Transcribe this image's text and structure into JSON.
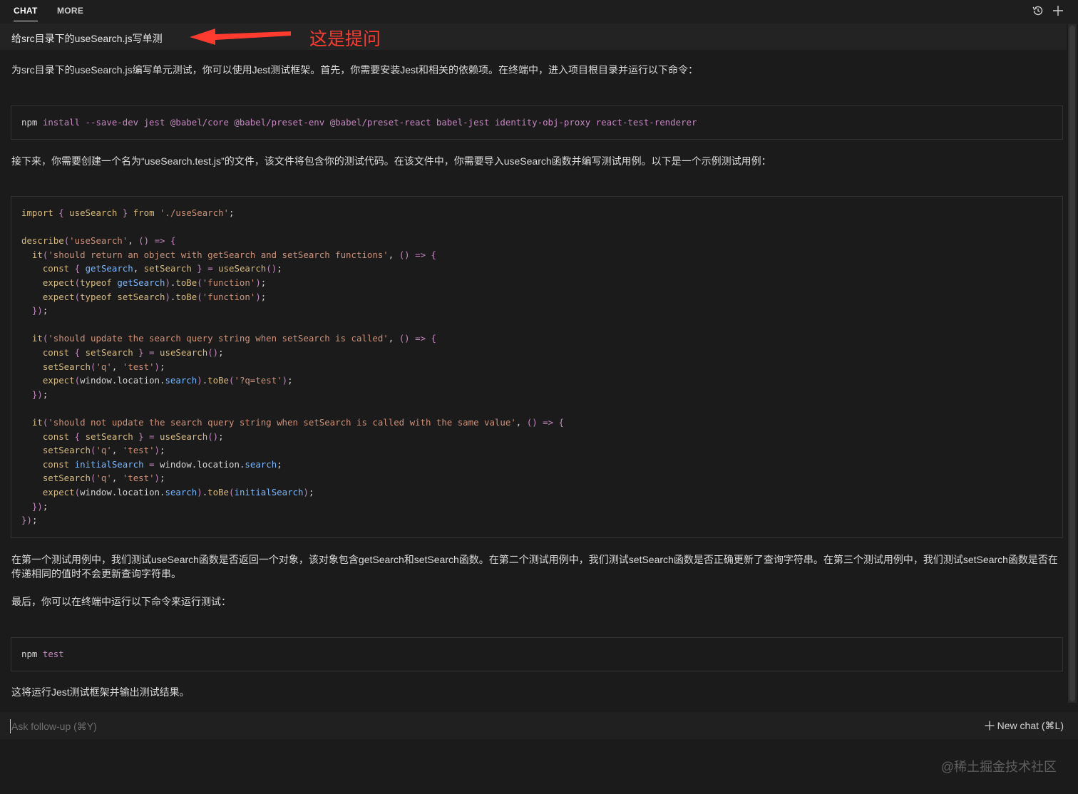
{
  "tabs": [
    {
      "label": "CHAT",
      "active": true
    },
    {
      "label": "MORE",
      "active": false
    }
  ],
  "header_icons": [
    "history-icon",
    "plus-icon"
  ],
  "question": "给src目录下的useSearch.js写单测",
  "annotation": "这是提问",
  "answer": {
    "intro": "为src目录下的useSearch.js编写单元测试，你可以使用Jest测试框架。首先，你需要安装Jest和相关的依赖项。在终端中，进入项目根目录并运行以下命令：",
    "install_cmd": {
      "cmd": "npm",
      "args": "install --save-dev jest @babel/core @babel/preset-env @babel/preset-react babel-jest identity-obj-proxy react-test-renderer"
    },
    "next": "接下来，你需要创建一个名为“useSearch.test.js”的文件，该文件将包含你的测试代码。在该文件中，你需要导入useSearch函数并编写测试用例。以下是一个示例测试用例：",
    "code_lines": [
      "import { useSearch } from './useSearch';",
      "",
      "describe('useSearch', () => {",
      "  it('should return an object with getSearch and setSearch functions', () => {",
      "    const { getSearch, setSearch } = useSearch();",
      "    expect(typeof getSearch).toBe('function');",
      "    expect(typeof setSearch).toBe('function');",
      "  });",
      "",
      "  it('should update the search query string when setSearch is called', () => {",
      "    const { setSearch } = useSearch();",
      "    setSearch('q', 'test');",
      "    expect(window.location.search).toBe('?q=test');",
      "  });",
      "",
      "  it('should not update the search query string when setSearch is called with the same value', () => {",
      "    const { setSearch } = useSearch();",
      "    setSearch('q', 'test');",
      "    const initialSearch = window.location.search;",
      "    setSearch('q', 'test');",
      "    expect(window.location.search).toBe(initialSearch);",
      "  });",
      "});"
    ],
    "explanation": "在第一个测试用例中，我们测试useSearch函数是否返回一个对象，该对象包含getSearch和setSearch函数。在第二个测试用例中，我们测试setSearch函数是否正确更新了查询字符串。在第三个测试用例中，我们测试setSearch函数是否在传递相同的值时不会更新查询字符串。",
    "finally": "最后，你可以在终端中运行以下命令来运行测试：",
    "test_cmd": {
      "cmd": "npm",
      "args": "test"
    },
    "result": "这将运行Jest测试框架并输出测试结果。"
  },
  "followup": {
    "placeholder": "Ask follow-up (⌘Y)",
    "value": ""
  },
  "new_chat_label": "New chat (⌘L)",
  "watermark": "@稀土掘金技术社区",
  "colors": {
    "background": "#1b1b1c",
    "question_bar": "#232324",
    "annotation": "#ff3b30",
    "code_keyword": "#d7ba7d",
    "code_string": "#ce9178",
    "code_identifier": "#79b8ff",
    "code_punct": "#c586c0"
  }
}
